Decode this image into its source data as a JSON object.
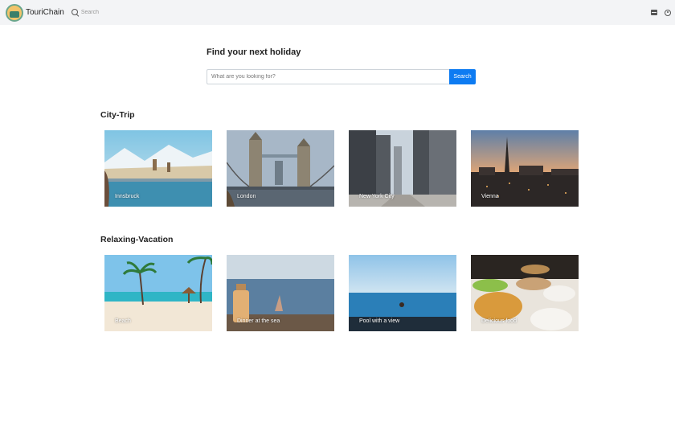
{
  "navbar": {
    "brand": "TouriChain",
    "search_placeholder": "Search",
    "icons": [
      "logo-icon",
      "search-icon",
      "card-icon",
      "user-icon"
    ]
  },
  "hero": {
    "title": "Find your next holiday",
    "search_placeholder": "What are you looking for?",
    "search_button": "Search",
    "accent_color": "#0d7bf2"
  },
  "sections": [
    {
      "title": "City-Trip",
      "cards": [
        {
          "label": "Innsbruck"
        },
        {
          "label": "London"
        },
        {
          "label": "New York City"
        },
        {
          "label": "Vienna"
        }
      ]
    },
    {
      "title": "Relaxing-Vacation",
      "cards": [
        {
          "label": "Beach"
        },
        {
          "label": "Dinner at the sea"
        },
        {
          "label": "Pool with a view"
        },
        {
          "label": "Delicious food"
        }
      ]
    }
  ]
}
